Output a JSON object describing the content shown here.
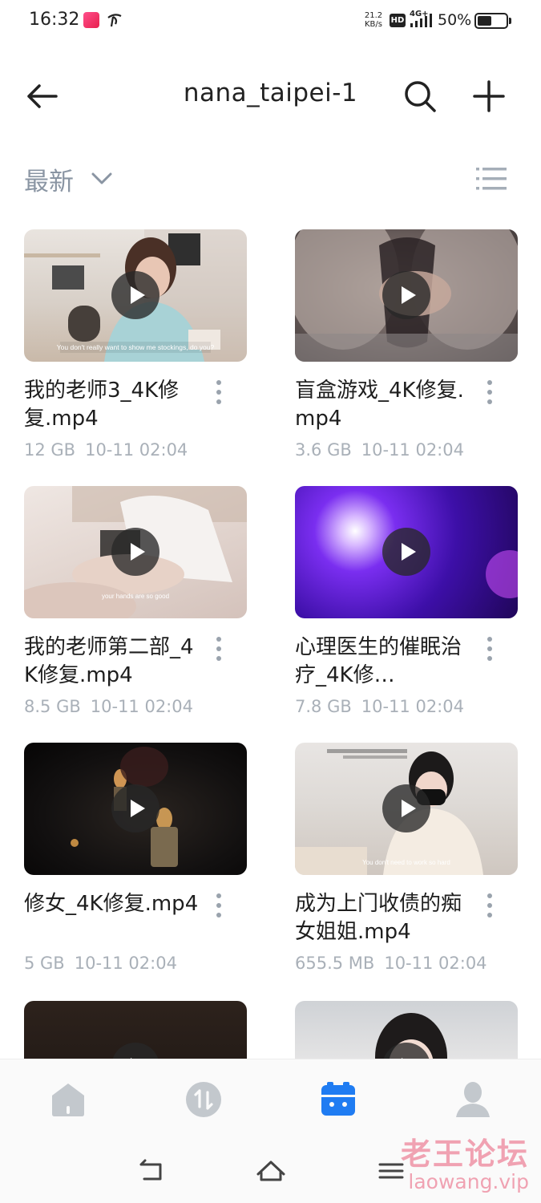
{
  "status_bar": {
    "time": "16:32",
    "speed_value": "21.2",
    "speed_unit": "KB/s",
    "hd": "HD",
    "network": "4G+",
    "battery_text": "50%",
    "battery_level": 0.5
  },
  "header": {
    "title": "nana_taipei-1",
    "back_icon": "arrow-left-icon",
    "search_icon": "search-icon",
    "add_icon": "plus-icon"
  },
  "sort": {
    "label": "最新",
    "chevron_icon": "chevron-down-icon",
    "view_icon": "list-view-icon"
  },
  "files": [
    {
      "name": "我的老师3_4K修复.mp4",
      "size": "12 GB",
      "date": "10-11 02:04",
      "caption": "You don't really want to show me stockings, do you?"
    },
    {
      "name": "盲盒游戏_4K修复.mp4",
      "size": "3.6 GB",
      "date": "10-11 02:04"
    },
    {
      "name": "我的老师第二部_4K修复.mp4",
      "size": "8.5 GB",
      "date": "10-11 02:04",
      "caption": "your hands are so good"
    },
    {
      "name": "心理医生的催眠治疗_4K修…",
      "size": "7.8 GB",
      "date": "10-11 02:04"
    },
    {
      "name": "修女_4K修复.mp4",
      "size": "5 GB",
      "date": "10-11 02:04"
    },
    {
      "name": "成为上门收债的痴女姐姐.mp4",
      "size": "655.5 MB",
      "date": "10-11 02:04",
      "caption": "You don't need to work so hard"
    },
    {
      "name": "",
      "size": "",
      "date": ""
    },
    {
      "name": "",
      "size": "",
      "date": ""
    }
  ],
  "bottom_nav": [
    {
      "icon": "home-icon",
      "active": false
    },
    {
      "icon": "transfer-icon",
      "active": false
    },
    {
      "icon": "files-icon",
      "active": true
    },
    {
      "icon": "profile-icon",
      "active": false
    }
  ],
  "watermark": {
    "chinese": "老王论坛",
    "url": "laowang.vip"
  },
  "colors": {
    "accent": "#1f7cf2",
    "inactive_icon": "#c3c8cd",
    "meta_text": "#a9b0b8",
    "sort_text": "#8a95a3"
  }
}
